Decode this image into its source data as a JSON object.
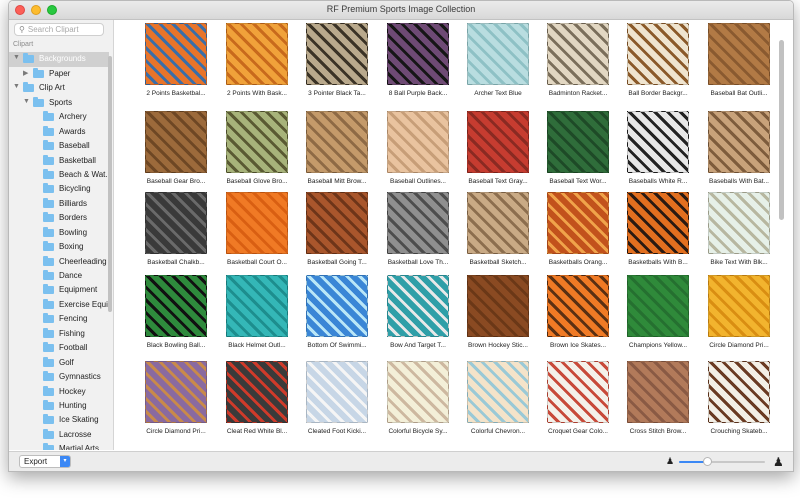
{
  "window": {
    "title": "RF Premium Sports Image Collection"
  },
  "sidebar": {
    "search_placeholder": "Search Clipart",
    "section_header": "Clipart",
    "tree": [
      {
        "label": "Backgrounds",
        "level": 0,
        "expanded": true,
        "selected": true
      },
      {
        "label": "Paper",
        "level": 1,
        "expanded": false,
        "has_children": true
      },
      {
        "label": "Clip Art",
        "level": 0,
        "expanded": true
      },
      {
        "label": "Sports",
        "level": 1,
        "expanded": true
      },
      {
        "label": "Archery",
        "level": 2
      },
      {
        "label": "Awards",
        "level": 2
      },
      {
        "label": "Baseball",
        "level": 2
      },
      {
        "label": "Basketball",
        "level": 2
      },
      {
        "label": "Beach & Wat...",
        "level": 2
      },
      {
        "label": "Bicycling",
        "level": 2
      },
      {
        "label": "Billiards",
        "level": 2
      },
      {
        "label": "Borders",
        "level": 2
      },
      {
        "label": "Bowling",
        "level": 2
      },
      {
        "label": "Boxing",
        "level": 2
      },
      {
        "label": "Cheerleading",
        "level": 2
      },
      {
        "label": "Dance",
        "level": 2
      },
      {
        "label": "Equipment",
        "level": 2
      },
      {
        "label": "Exercise Equi...",
        "level": 2
      },
      {
        "label": "Fencing",
        "level": 2
      },
      {
        "label": "Fishing",
        "level": 2
      },
      {
        "label": "Football",
        "level": 2
      },
      {
        "label": "Golf",
        "level": 2
      },
      {
        "label": "Gymnastics",
        "level": 2
      },
      {
        "label": "Hockey",
        "level": 2
      },
      {
        "label": "Hunting",
        "level": 2
      },
      {
        "label": "Ice Skating",
        "level": 2
      },
      {
        "label": "Lacrosse",
        "level": 2
      },
      {
        "label": "Martial Arts",
        "level": 2
      }
    ]
  },
  "bottombar": {
    "export_label": "Export",
    "zoom_level": 0.33
  },
  "grid": {
    "items": [
      {
        "caption": "2 Points Basketbal...",
        "colors": [
          "#e8742a",
          "#3a6ea8"
        ]
      },
      {
        "caption": "2 Points With Bask...",
        "colors": [
          "#f0a23a",
          "#c86a1c"
        ]
      },
      {
        "caption": "3 Pointer Black Ta...",
        "colors": [
          "#b9a98c",
          "#3b3326"
        ]
      },
      {
        "caption": "8 Ball Purple Back...",
        "colors": [
          "#6e4a74",
          "#161616"
        ]
      },
      {
        "caption": "Archer Text Blue",
        "colors": [
          "#b9dde0",
          "#8ec1c5"
        ]
      },
      {
        "caption": "Badminton Racket...",
        "colors": [
          "#e2d7c2",
          "#7b6f5b"
        ]
      },
      {
        "caption": "Ball Border Backgr...",
        "colors": [
          "#efe4cf",
          "#8b5a2a"
        ]
      },
      {
        "caption": "Baseball Bat Outli...",
        "colors": [
          "#b27a45",
          "#8a5a30"
        ]
      },
      {
        "caption": "Baseball Gear Bro...",
        "colors": [
          "#9c6a3b",
          "#6e4724"
        ]
      },
      {
        "caption": "Baseball Glove Bro...",
        "colors": [
          "#a7b37a",
          "#5a5a33"
        ]
      },
      {
        "caption": "Baseball Mitt Brow...",
        "colors": [
          "#c49a6a",
          "#8e6a45"
        ]
      },
      {
        "caption": "Baseball Outlines...",
        "colors": [
          "#e9c39f",
          "#c79e78"
        ]
      },
      {
        "caption": "Baseball Text Gray...",
        "colors": [
          "#c63c30",
          "#8a2a22"
        ]
      },
      {
        "caption": "Baseball Text Wor...",
        "colors": [
          "#2f6d3a",
          "#1e4a27"
        ]
      },
      {
        "caption": "Baseballs White R...",
        "colors": [
          "#e7e7e7",
          "#222222"
        ]
      },
      {
        "caption": "Baseballs With Bat...",
        "colors": [
          "#c8a27a",
          "#7e5c3c"
        ]
      },
      {
        "caption": "Basketball Chalkb...",
        "colors": [
          "#3a3a3a",
          "#6a6a6a"
        ]
      },
      {
        "caption": "Basketball Court O...",
        "colors": [
          "#f07a25",
          "#d95f12"
        ]
      },
      {
        "caption": "Basketball Going T...",
        "colors": [
          "#a9562c",
          "#6e3519"
        ]
      },
      {
        "caption": "Basketball Love Th...",
        "colors": [
          "#8f8f8f",
          "#4d4d4d"
        ]
      },
      {
        "caption": "Basketball Sketch...",
        "colors": [
          "#c9aa85",
          "#8c6e4e"
        ]
      },
      {
        "caption": "Basketballs Orang...",
        "colors": [
          "#c2521c",
          "#f0a34a"
        ]
      },
      {
        "caption": "Basketballs With B...",
        "colors": [
          "#e26f1f",
          "#2a1a12"
        ]
      },
      {
        "caption": "Bike Text With Blk...",
        "colors": [
          "#e6f0e8",
          "#b7b7a0"
        ]
      },
      {
        "caption": "Black Bowling Ball...",
        "colors": [
          "#2e8a3c",
          "#111111"
        ]
      },
      {
        "caption": "Black Helmet Outl...",
        "colors": [
          "#34b7b7",
          "#1d8e8e"
        ]
      },
      {
        "caption": "Bottom Of Swimmi...",
        "colors": [
          "#3a86d6",
          "#b9e6f7"
        ]
      },
      {
        "caption": "Bow And Target T...",
        "colors": [
          "#2f9fa8",
          "#e8e8e8"
        ]
      },
      {
        "caption": "Brown Hockey Stic...",
        "colors": [
          "#8a4a22",
          "#6b3817"
        ]
      },
      {
        "caption": "Brown Ice Skates...",
        "colors": [
          "#f07a25",
          "#5a3013"
        ]
      },
      {
        "caption": "Champions Yellow...",
        "colors": [
          "#2f8a3a",
          "#257030"
        ]
      },
      {
        "caption": "Circle Diamond Pri...",
        "colors": [
          "#f2b42e",
          "#d98e12"
        ]
      },
      {
        "caption": "Circle Diamond Pri...",
        "colors": [
          "#8a6aa0",
          "#c98a4a"
        ]
      },
      {
        "caption": "Cleat Red White Bl...",
        "colors": [
          "#3a3a3a",
          "#cf3a2a"
        ]
      },
      {
        "caption": "Cleated Foot Kicki...",
        "colors": [
          "#c7d6e6",
          "#f5f5f5"
        ]
      },
      {
        "caption": "Colorful Bicycle Sy...",
        "colors": [
          "#f3efd8",
          "#cdb8a0"
        ]
      },
      {
        "caption": "Colorful Chevron...",
        "colors": [
          "#f4e3c9",
          "#9ac9d6"
        ]
      },
      {
        "caption": "Croquet Gear Colo...",
        "colors": [
          "#f4f1ea",
          "#c84a3a"
        ]
      },
      {
        "caption": "Cross Stitch Brow...",
        "colors": [
          "#b27a5a",
          "#8a5a44"
        ]
      },
      {
        "caption": "Crouching Skateb...",
        "colors": [
          "#f3efe6",
          "#6a3a22"
        ]
      }
    ]
  }
}
